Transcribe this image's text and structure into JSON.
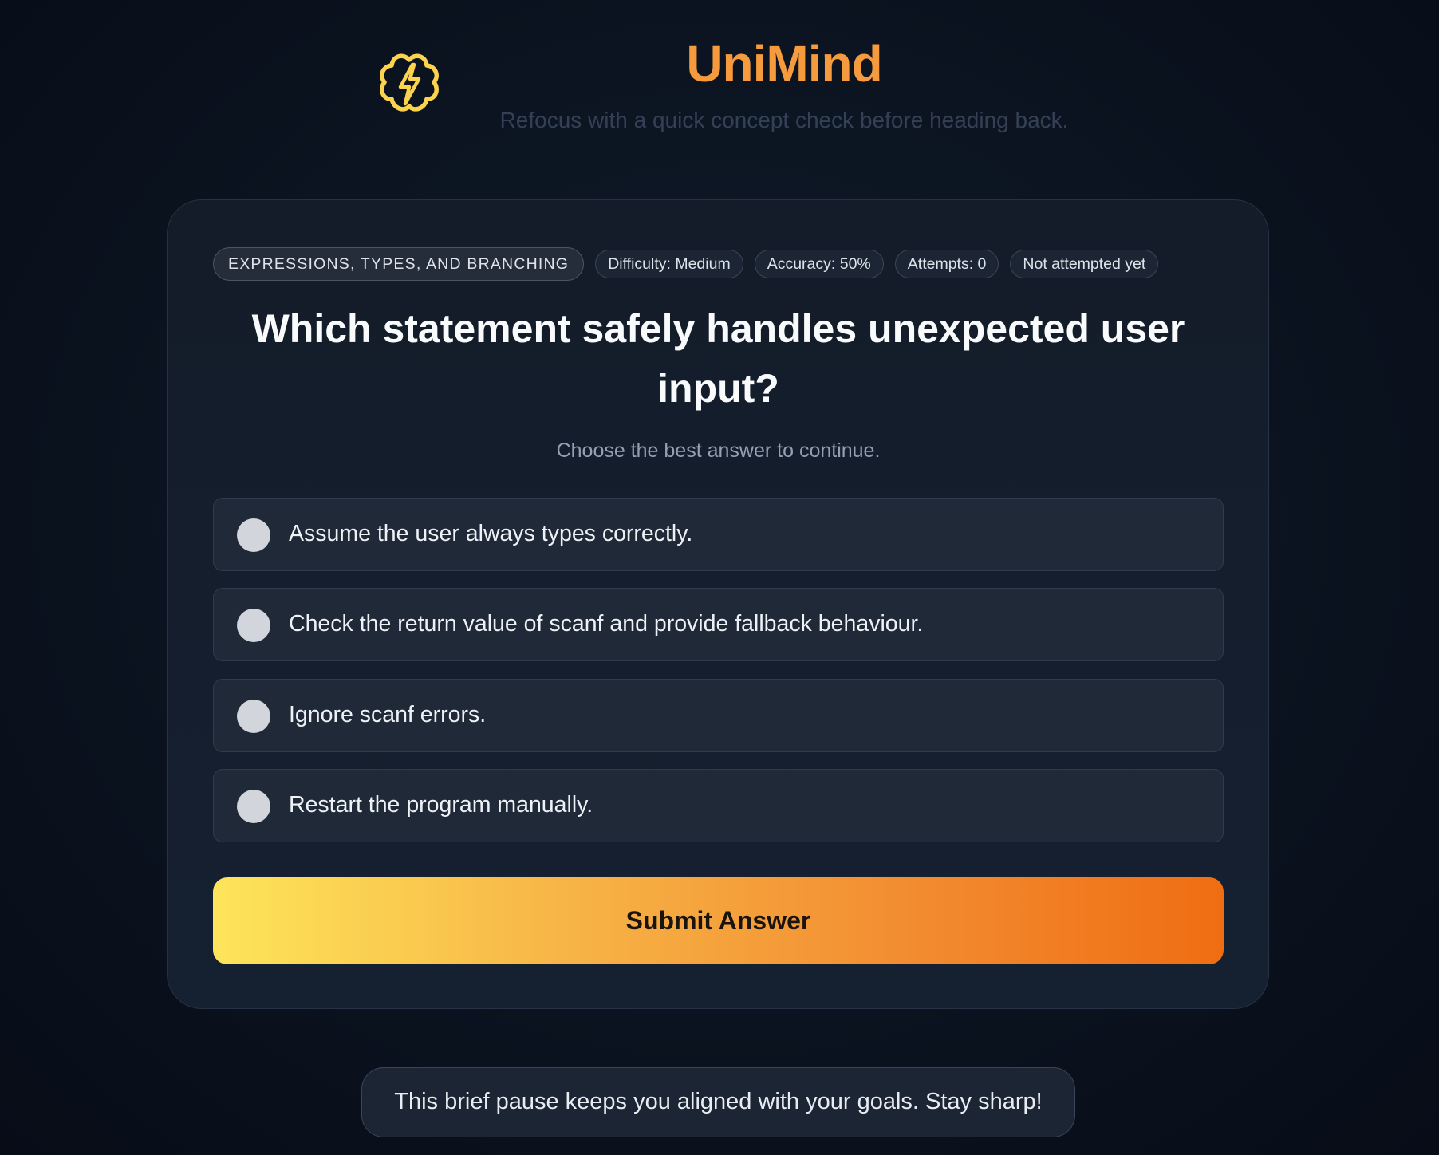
{
  "header": {
    "logo_icon": "brain-lightning-icon",
    "title": "UniMind",
    "subtitle": "Refocus with a quick concept check before heading back."
  },
  "quiz": {
    "tags": [
      "EXPRESSIONS, TYPES, AND BRANCHING",
      "Difficulty: Medium",
      "Accuracy: 50%",
      "Attempts: 0",
      "Not attempted yet"
    ],
    "question": "Which statement safely handles unexpected user input?",
    "instruction": "Choose the best answer to continue.",
    "options": [
      {
        "label": "Assume the user always types correctly.",
        "selected": false
      },
      {
        "label": "Check the return value of scanf and provide fallback behaviour.",
        "selected": false
      },
      {
        "label": "Ignore scanf errors.",
        "selected": false
      },
      {
        "label": "Restart the program manually.",
        "selected": false
      }
    ],
    "submit_label": "Submit Answer"
  },
  "footer": {
    "message": "This brief pause keeps you aligned with your goals. Stay sharp!"
  },
  "colors": {
    "brand": "#f59a3d",
    "logo": "#fcd34d",
    "submit_gradient_start": "#fde55a",
    "submit_gradient_end": "#f06d12"
  }
}
